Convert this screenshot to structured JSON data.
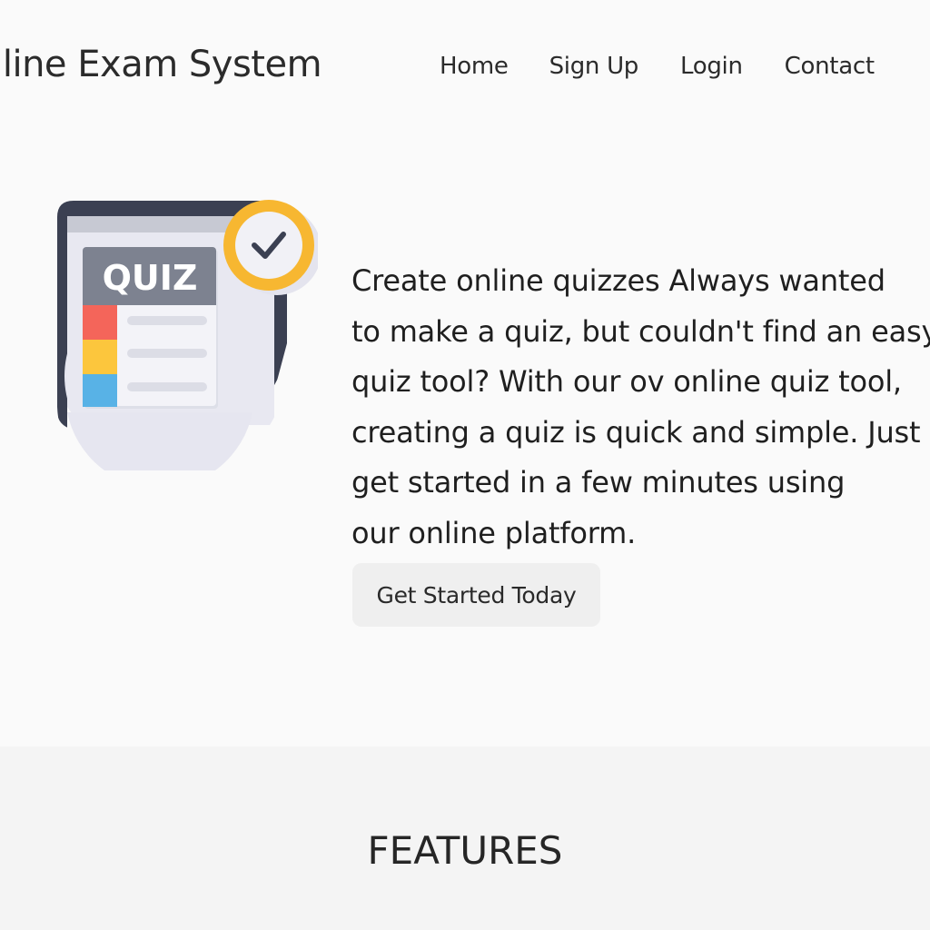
{
  "header": {
    "brand": "nline Exam System",
    "nav": [
      {
        "label": "Home"
      },
      {
        "label": "Sign Up"
      },
      {
        "label": "Login"
      },
      {
        "label": "Contact"
      }
    ]
  },
  "hero": {
    "illustration": {
      "label": "QUIZ",
      "icon": "quiz-document-checkmark-icon",
      "colors": {
        "frame": "#3b4052",
        "badge_ring": "#f7b731",
        "header_bar": "#7d8290",
        "stripe_red": "#f4655a",
        "stripe_yellow": "#fcc63d",
        "stripe_blue": "#58b2e6"
      }
    },
    "paragraph_lines": [
      "Create online quizzes Always wanted",
      "to make a quiz, but couldn't find an easy",
      "quiz tool? With our ov online quiz tool,",
      "creating a quiz is quick and simple. Just",
      "get started in a few minutes using",
      "our online platform."
    ],
    "cta_label": "Get Started Today"
  },
  "features": {
    "title": "FEATURES"
  }
}
